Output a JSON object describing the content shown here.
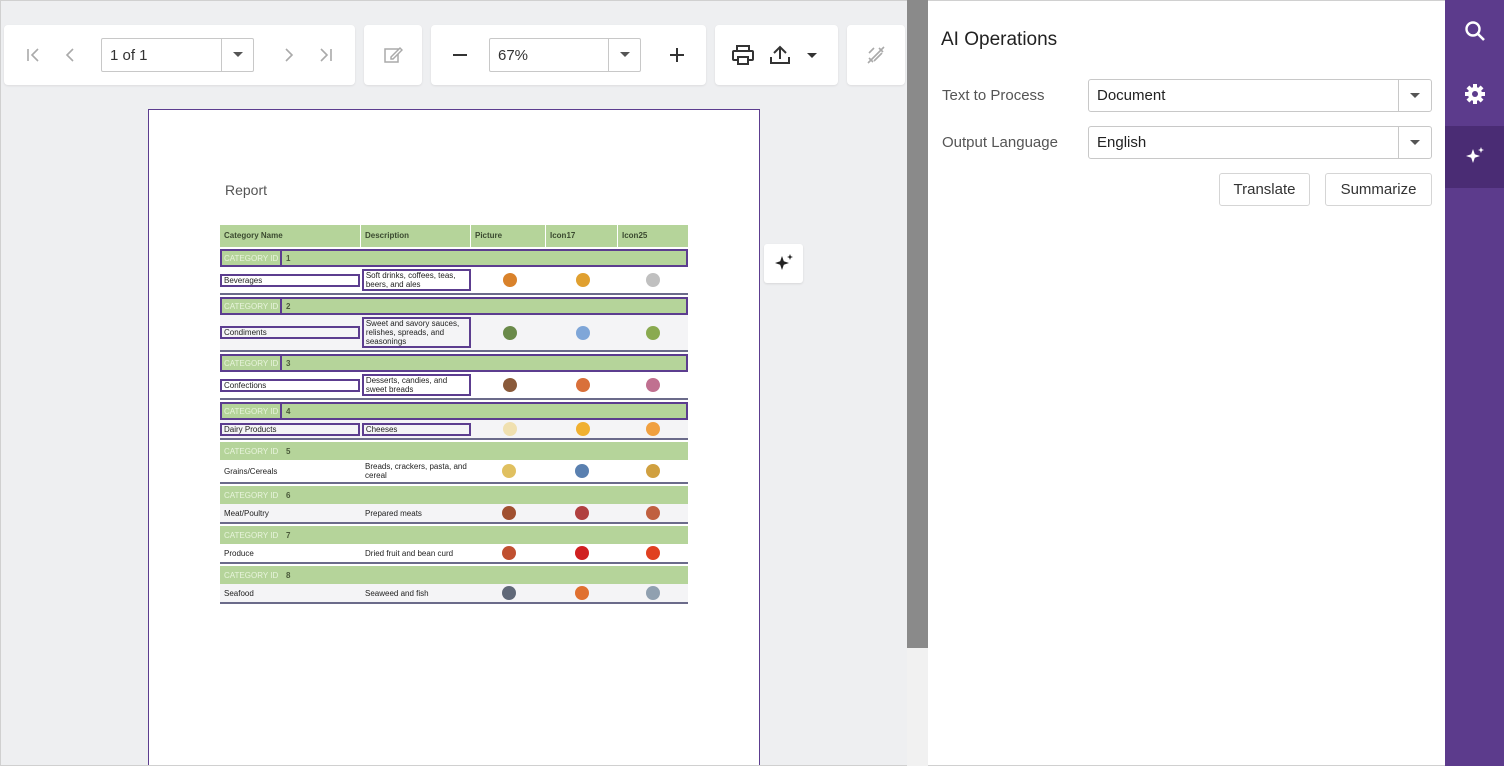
{
  "toolbar": {
    "page_value": "1 of 1",
    "zoom_value": "67%"
  },
  "report": {
    "title": "Report",
    "columns": [
      "Category Name",
      "Description",
      "Picture",
      "Icon17",
      "Icon25"
    ],
    "group_label": "CATEGORY ID",
    "groups": [
      {
        "id": "1",
        "name": "Beverages",
        "description": "Soft drinks, coffees, teas, beers, and ales",
        "icon_colors": [
          "#d9822b",
          "#e0a030",
          "#c0c0c0"
        ]
      },
      {
        "id": "2",
        "name": "Condiments",
        "description": "Sweet and savory sauces, relishes, spreads, and seasonings",
        "icon_colors": [
          "#6a8a4a",
          "#7fa6d8",
          "#8aaa50"
        ]
      },
      {
        "id": "3",
        "name": "Confections",
        "description": "Desserts, candies, and sweet breads",
        "icon_colors": [
          "#8a5a3a",
          "#d9703a",
          "#c07090"
        ]
      },
      {
        "id": "4",
        "name": "Dairy Products",
        "description": "Cheeses",
        "icon_colors": [
          "#f0e0b0",
          "#f0b030",
          "#f0a040"
        ]
      },
      {
        "id": "5",
        "name": "Grains/Cereals",
        "description": "Breads, crackers, pasta, and cereal",
        "icon_colors": [
          "#e0c060",
          "#5a80b0",
          "#d0a040"
        ]
      },
      {
        "id": "6",
        "name": "Meat/Poultry",
        "description": "Prepared meats",
        "icon_colors": [
          "#a05030",
          "#b04040",
          "#c06040"
        ]
      },
      {
        "id": "7",
        "name": "Produce",
        "description": "Dried fruit and bean curd",
        "icon_colors": [
          "#c05030",
          "#d02020",
          "#e04020"
        ]
      },
      {
        "id": "8",
        "name": "Seafood",
        "description": "Seaweed and fish",
        "icon_colors": [
          "#606878",
          "#e07030",
          "#90a0b0"
        ]
      }
    ]
  },
  "panel": {
    "title": "AI Operations",
    "text_label": "Text to Process",
    "text_value": "Document",
    "lang_label": "Output Language",
    "lang_value": "English",
    "translate_label": "Translate",
    "summarize_label": "Summarize"
  },
  "colors": {
    "accent": "#5c3b8c",
    "group_band": "#b5d49a"
  }
}
